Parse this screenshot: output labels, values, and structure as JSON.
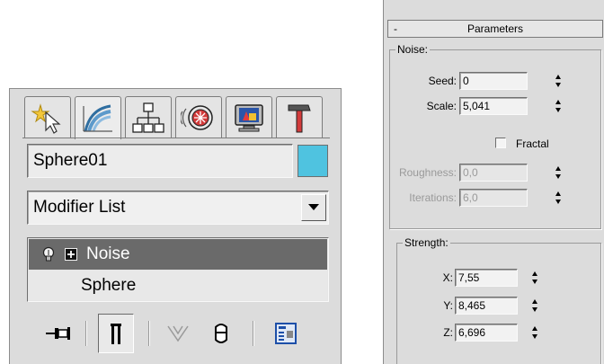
{
  "command_panel": {
    "tabs": [
      {
        "icon": "create-icon"
      },
      {
        "icon": "modify-icon"
      },
      {
        "icon": "hierarchy-icon"
      },
      {
        "icon": "motion-icon"
      },
      {
        "icon": "display-icon"
      },
      {
        "icon": "utilities-icon"
      }
    ],
    "object_name": "Sphere01",
    "object_color": "#4fc3e0",
    "modifier_list": "Modifier List",
    "stack": {
      "items": [
        {
          "label": "Noise",
          "selected": true
        },
        {
          "label": "Sphere",
          "selected": false
        }
      ]
    },
    "tools": [
      "pin-stack-icon",
      "show-end-result-icon",
      "make-unique-icon",
      "remove-modifier-icon",
      "configure-sets-icon"
    ]
  },
  "parameters": {
    "title": "Parameters",
    "collapse_glyph": "-",
    "noise": {
      "title": "Noise:",
      "seed_label": "Seed:",
      "seed_value": "0",
      "scale_label": "Scale:",
      "scale_value": "5,041",
      "fractal_label": "Fractal",
      "fractal_checked": false,
      "roughness_label": "Roughness:",
      "roughness_value": "0,0",
      "iterations_label": "Iterations:",
      "iterations_value": "6,0"
    },
    "strength": {
      "title": "Strength:",
      "x_label": "X:",
      "x_value": "7,55",
      "y_label": "Y:",
      "y_value": "8,465",
      "z_label": "Z:",
      "z_value": "6,696"
    }
  }
}
